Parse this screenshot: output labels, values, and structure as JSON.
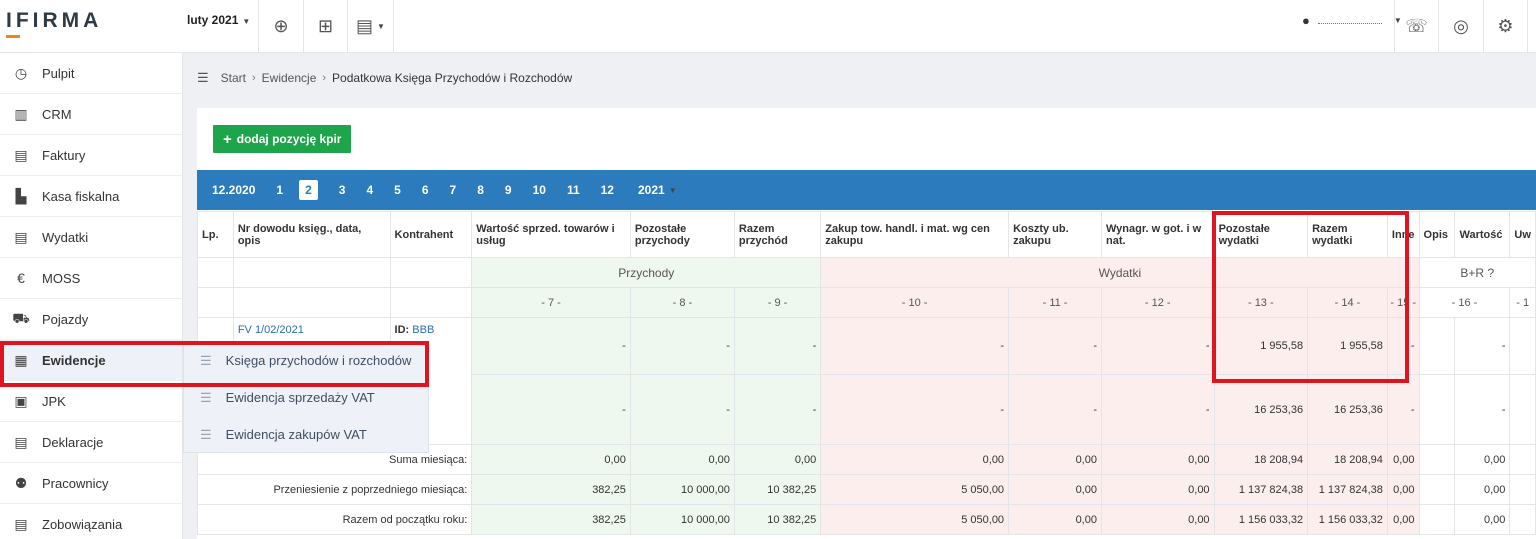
{
  "logo": "IFIRMA",
  "period": "luty 2021",
  "sidebar": {
    "items": [
      {
        "label": "Pulpit",
        "icon": "speedometer-icon",
        "glyph": "◷"
      },
      {
        "label": "CRM",
        "icon": "crm-icon",
        "glyph": "▥"
      },
      {
        "label": "Faktury",
        "icon": "invoice-icon",
        "glyph": "▤"
      },
      {
        "label": "Kasa fiskalna",
        "icon": "cash-register-icon",
        "glyph": "▙"
      },
      {
        "label": "Wydatki",
        "icon": "receipt-icon",
        "glyph": "▤"
      },
      {
        "label": "MOSS",
        "icon": "moss-icon",
        "glyph": "€"
      },
      {
        "label": "Pojazdy",
        "icon": "car-icon",
        "glyph": "⛟"
      },
      {
        "label": "Ewidencje",
        "icon": "ledger-icon",
        "glyph": "▦"
      },
      {
        "label": "JPK",
        "icon": "jpk-icon",
        "glyph": "▣"
      },
      {
        "label": "Deklaracje",
        "icon": "declaration-icon",
        "glyph": "▤"
      },
      {
        "label": "Pracownicy",
        "icon": "employees-icon",
        "glyph": "⚉"
      },
      {
        "label": "Zobowiązania",
        "icon": "obligations-icon",
        "glyph": "▤"
      }
    ]
  },
  "submenu": {
    "items": [
      {
        "label": "Księga przychodów i rozchodów"
      },
      {
        "label": "Ewidencja sprzedaży VAT"
      },
      {
        "label": "Ewidencja zakupów VAT"
      }
    ]
  },
  "breadcrumb": {
    "items": [
      "Start",
      "Ewidencje",
      "Podatkowa Księga Przychodów i Rozchodów"
    ]
  },
  "add_button": "dodaj pozycję kpir",
  "months": [
    "12.2020",
    "1",
    "2",
    "3",
    "4",
    "5",
    "6",
    "7",
    "8",
    "9",
    "10",
    "11",
    "12"
  ],
  "current_month": "2",
  "year_selector": "2021",
  "table": {
    "headers": {
      "lp": "Lp.",
      "doc": "Nr dowodu księg., data, opis",
      "contractor": "Kontrahent",
      "c7": "Wartość sprzed. towarów i usług",
      "c8": "Pozostałe przychody",
      "c9": "Razem przychód",
      "c10": "Zakup tow. handl. i mat. wg cen zakupu",
      "c11": "Koszty ub. zakupu",
      "c12": "Wynagr. w got. i w nat.",
      "c13": "Pozostałe wydatki",
      "c14": "Razem wydatki",
      "c15": "Inne",
      "c16a": "Opis",
      "c16b": "Wartość",
      "c17": "Uw"
    },
    "groups": {
      "income": "Przychody",
      "expenses": "Wydatki",
      "br": "B+R"
    },
    "colnums": {
      "c7": "- 7 -",
      "c8": "- 8 -",
      "c9": "- 9 -",
      "c10": "- 10 -",
      "c11": "- 11 -",
      "c12": "- 12 -",
      "c13": "- 13 -",
      "c14": "- 14 -",
      "c15": "- 15 -",
      "c16": "- 16 -",
      "c17": "- 1"
    },
    "row1": {
      "doc": "FV 1/02/2021",
      "id_label": "ID:",
      "id_value": "BBB",
      "c7": "-",
      "c8": "-",
      "c9": "-",
      "c10": "-",
      "c11": "-",
      "c12": "-",
      "c13": "1 955,58",
      "c14": "1 955,58",
      "c15": "-",
      "c16b": "-"
    },
    "row2": {
      "c7": "-",
      "c8": "-",
      "c9": "-",
      "c10": "-",
      "c11": "-",
      "c12": "-",
      "c13": "16 253,36",
      "c14": "16 253,36",
      "c15": "-",
      "c16b": "-"
    },
    "sum_month": {
      "label": "Suma miesiąca:",
      "c7": "0,00",
      "c8": "0,00",
      "c9": "0,00",
      "c10": "0,00",
      "c11": "0,00",
      "c12": "0,00",
      "c13": "18 208,94",
      "c14": "18 208,94",
      "c15": "0,00",
      "c16b": "0,00"
    },
    "carried": {
      "label": "Przeniesienie z poprzedniego miesiąca:",
      "c7": "382,25",
      "c8": "10 000,00",
      "c9": "10 382,25",
      "c10": "5 050,00",
      "c11": "0,00",
      "c12": "0,00",
      "c13": "1 137 824,38",
      "c14": "1 137 824,38",
      "c15": "0,00",
      "c16b": "0,00"
    },
    "ytd": {
      "label": "Razem od początku roku:",
      "c7": "382,25",
      "c8": "10 000,00",
      "c9": "10 382,25",
      "c10": "5 050,00",
      "c11": "0,00",
      "c12": "0,00",
      "c13": "1 156 033,32",
      "c14": "1 156 033,32",
      "c15": "0,00",
      "c16b": "0,00"
    }
  }
}
